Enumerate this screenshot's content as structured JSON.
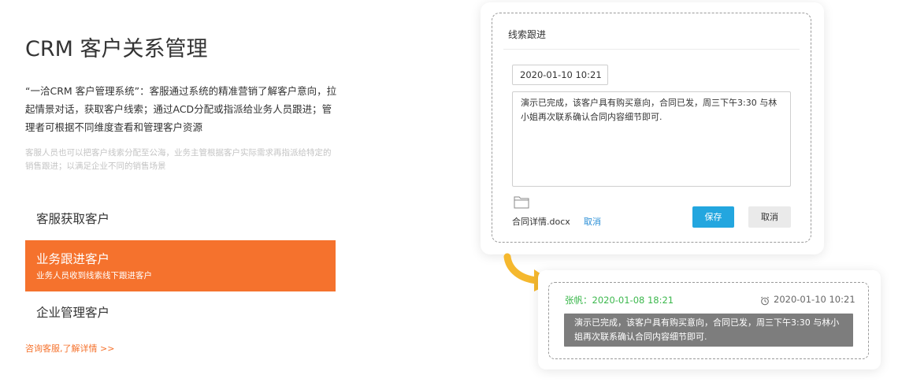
{
  "left": {
    "title": "CRM 客户关系管理",
    "description": "“一洽CRM 客户管理系统”：客服通过系统的精准营销了解客户意向，拉起情景对话，获取客户线索；通过ACD分配或指派给业务人员跟进；管理者可根据不同维度查看和管理客户资源",
    "note": "客服人员也可以把客户线索分配至公海，业务主管根据客户实际需求再指派给特定的销售跟进；以满足企业不同的销售场景",
    "features": [
      {
        "label": "客服获取客户"
      },
      {
        "label": "业务跟进客户",
        "subtitle": "业务人员收到线索线下跟进客户"
      },
      {
        "label": "企业管理客户"
      }
    ],
    "more_link": "咨询客服,了解详情 >>"
  },
  "follow_up_card": {
    "title": "线索跟进",
    "date_value": "2020-01-10   10:21",
    "note_text": "演示已完成，该客户具有购买意向，合同已发，周三下午3:30 与林小姐再次联系确认合同内容细节即可.",
    "attachment_name": "合同详情.docx",
    "attachment_cancel": "取消",
    "save_label": "保存",
    "cancel_label": "取消"
  },
  "record_card": {
    "author_time": "张帆：2020-01-08    18:21",
    "reminder": "2020-01-10   10:21",
    "message": "演示已完成，该客户具有购买意向，合同已发，周三下午3:30 与林小姐再次联系确认合同内容细节即可."
  },
  "colors": {
    "accent_orange": "#f5722d",
    "save_blue": "#23a6df",
    "link_blue": "#2b8fd6",
    "author_green": "#3cb84d",
    "arrow_yellow": "#f5b82e"
  },
  "icons": {
    "folder": "folder-icon",
    "alarm": "alarm-clock-icon",
    "arrow": "curved-arrow-icon"
  }
}
